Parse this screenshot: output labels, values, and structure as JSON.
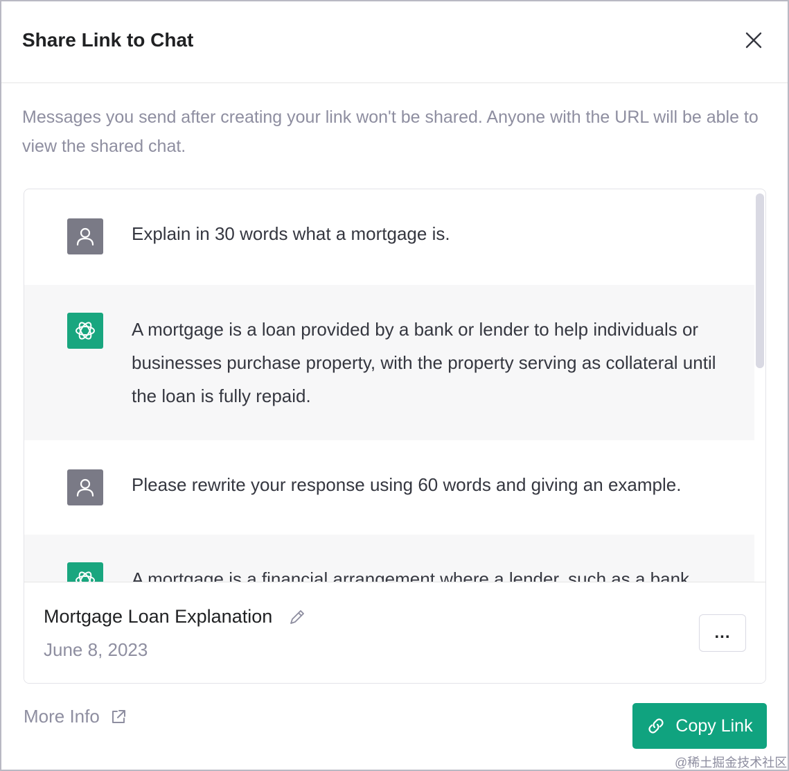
{
  "dialog": {
    "title": "Share Link to Chat",
    "notice": "Messages you send after creating your link won't be shared. Anyone with the URL will be able to view the shared chat."
  },
  "messages": [
    {
      "role": "user",
      "text": "Explain in 30 words what a mortgage is."
    },
    {
      "role": "assistant",
      "text": "A mortgage is a loan provided by a bank or lender to help individuals or businesses purchase property, with the property serving as collateral until the loan is fully repaid."
    },
    {
      "role": "user",
      "text": "Please rewrite your response using 60 words and giving an example."
    },
    {
      "role": "assistant",
      "text": "A mortgage is a financial arrangement where a lender, such as a bank"
    }
  ],
  "footer": {
    "chat_title": "Mortgage Loan Explanation",
    "chat_date": "June 8, 2023",
    "more_label": "..."
  },
  "actions": {
    "more_info": "More Info",
    "copy_link": "Copy Link"
  },
  "watermark": "@稀土掘金技术社区",
  "colors": {
    "accent": "#10a37f",
    "gpt_avatar": "#19a67f",
    "user_avatar": "#7a7a86",
    "assistant_row": "#f7f7f8"
  },
  "icons": {
    "close": "close-icon",
    "user": "user-icon",
    "assistant": "openai-logo-icon",
    "edit": "pencil-icon",
    "external": "external-link-icon",
    "link": "link-icon"
  }
}
